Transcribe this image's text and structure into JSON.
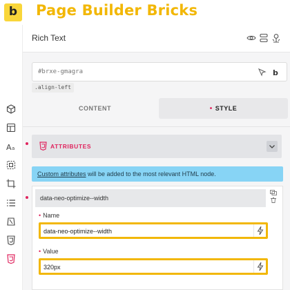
{
  "brand": {
    "logo_letter": "b",
    "title": "Page Builder Bricks"
  },
  "panel": {
    "title": "Rich Text",
    "header_icons": [
      "eye-icon",
      "stack-icon",
      "pin-person-icon"
    ],
    "selector": {
      "value": "#brxe-gmagra",
      "icons": [
        "cursor-icon",
        "bricks-b-icon"
      ]
    },
    "class_chip": ".align-left",
    "tabs": [
      {
        "label": "CONTENT",
        "active": false
      },
      {
        "label": "STYLE",
        "active": true
      }
    ]
  },
  "rail": {
    "icons": [
      "cube-icon",
      "layout-icon",
      "typography-icon",
      "border-icon",
      "crop-icon",
      "list-icon",
      "transform-icon",
      "css3-icon",
      "html5-icon"
    ]
  },
  "attributes": {
    "section_label": "ATTRIBUTES",
    "info_link": "Custom attributes",
    "info_text": " will be added to the most relevant HTML node.",
    "item_title": "data-neo-optimize--width",
    "name_label": "Name",
    "name_value": "data-neo-optimize--width",
    "value_label": "Value",
    "value_value": "320px"
  },
  "colors": {
    "brand_yellow": "#f2b705",
    "accent_pink": "#e0245e",
    "info_blue": "#87d4f5",
    "logo_yellow": "#f9d63a"
  }
}
